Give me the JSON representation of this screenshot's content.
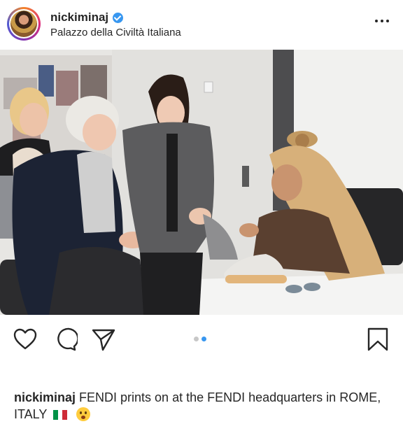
{
  "header": {
    "username": "nickiminaj",
    "verified": true,
    "location": "Palazzo della Civiltà Italiana",
    "more_icon": "more-horizontal-icon"
  },
  "post": {
    "image_alt": "",
    "carousel": {
      "total": 2,
      "active_index": 1,
      "active_color": "#3897f0",
      "inactive_color": "#c7c7c7"
    }
  },
  "actions": {
    "icons": [
      "heart-icon",
      "comment-icon",
      "share-icon",
      "bookmark-icon"
    ]
  },
  "caption": {
    "username": "nickiminaj",
    "text": " FENDI prints on at the FENDI headquarters in ROME, ITALY",
    "flag_icon": "italy-flag-icon",
    "emoji_icon": "shushing-face-emoji-icon"
  }
}
